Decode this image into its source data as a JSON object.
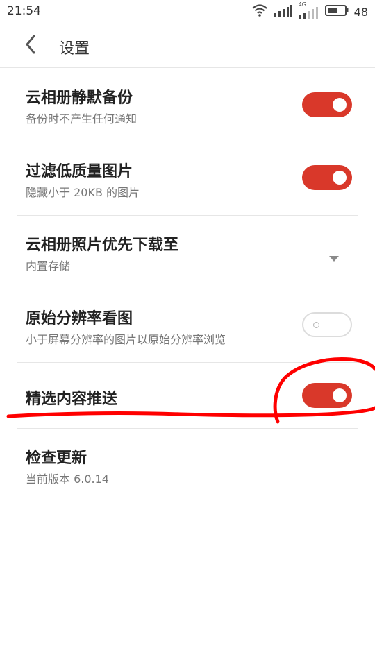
{
  "status": {
    "time": "21:54",
    "network_label": "4G",
    "battery": "48"
  },
  "header": {
    "title": "设置"
  },
  "settings": [
    {
      "title": "云相册静默备份",
      "subtitle": "备份时不产生任何通知",
      "control": "toggle",
      "on": true
    },
    {
      "title": "过滤低质量图片",
      "subtitle": "隐藏小于 20KB 的图片",
      "control": "toggle",
      "on": true
    },
    {
      "title": "云相册照片优先下载至",
      "subtitle": "内置存储",
      "control": "dropdown"
    },
    {
      "title": "原始分辨率看图",
      "subtitle": "小于屏幕分辨率的图片以原始分辨率浏览",
      "control": "toggle",
      "on": false
    },
    {
      "title": "精选内容推送",
      "control": "toggle",
      "on": true
    },
    {
      "title": "检查更新",
      "subtitle": "当前版本 6.0.14",
      "control": "none"
    }
  ],
  "colors": {
    "accent": "#d9382a",
    "annotation": "#ff0000"
  },
  "icons": {
    "back": "chevron-left-icon",
    "wifi": "wifi-icon",
    "signal": "signal-icon",
    "battery": "battery-icon",
    "dropdown": "triangle-down-icon"
  }
}
